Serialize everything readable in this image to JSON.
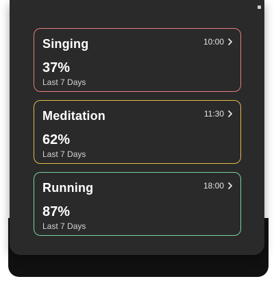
{
  "colors": {
    "panel": "#2a2a2a",
    "singing_border": "#e4807f",
    "meditation_border": "#e3bb4c",
    "running_border": "#7bd2a1"
  },
  "cards": [
    {
      "title": "Singing",
      "time": "10:00",
      "percent": "37%",
      "subtitle": "Last 7 Days",
      "icon": "chevron-right-icon"
    },
    {
      "title": "Meditation",
      "time": "11:30",
      "percent": "62%",
      "subtitle": "Last 7 Days",
      "icon": "chevron-right-icon"
    },
    {
      "title": "Running",
      "time": "18:00",
      "percent": "87%",
      "subtitle": "Last 7 Days",
      "icon": "chevron-right-icon"
    }
  ]
}
